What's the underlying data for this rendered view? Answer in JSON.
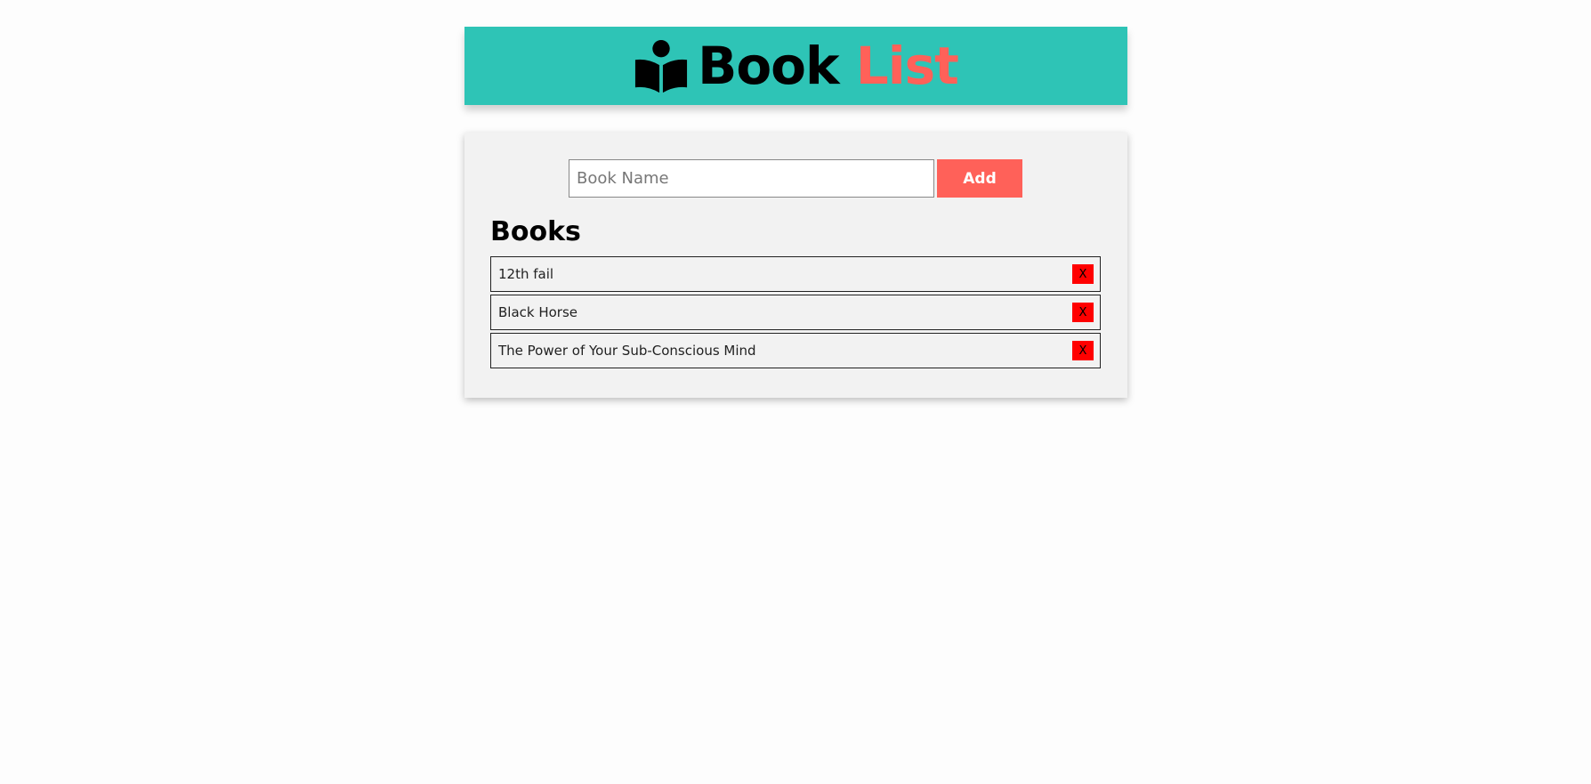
{
  "header": {
    "icon": "book-reader-icon",
    "title_main": "Book",
    "title_accent": "List",
    "colors": {
      "background": "#2ec4b6",
      "title_main": "#000000",
      "title_accent": "#ff6159"
    }
  },
  "form": {
    "input_placeholder": "Book Name",
    "input_value": "",
    "add_label": "Add",
    "add_color": "#ff6159"
  },
  "books": {
    "heading": "Books",
    "items": [
      {
        "name": "12th fail",
        "delete_label": "X"
      },
      {
        "name": "Black Horse",
        "delete_label": "X"
      },
      {
        "name": "The Power of Your Sub-Conscious Mind",
        "delete_label": "X"
      }
    ],
    "delete_color": "#ff0000"
  }
}
